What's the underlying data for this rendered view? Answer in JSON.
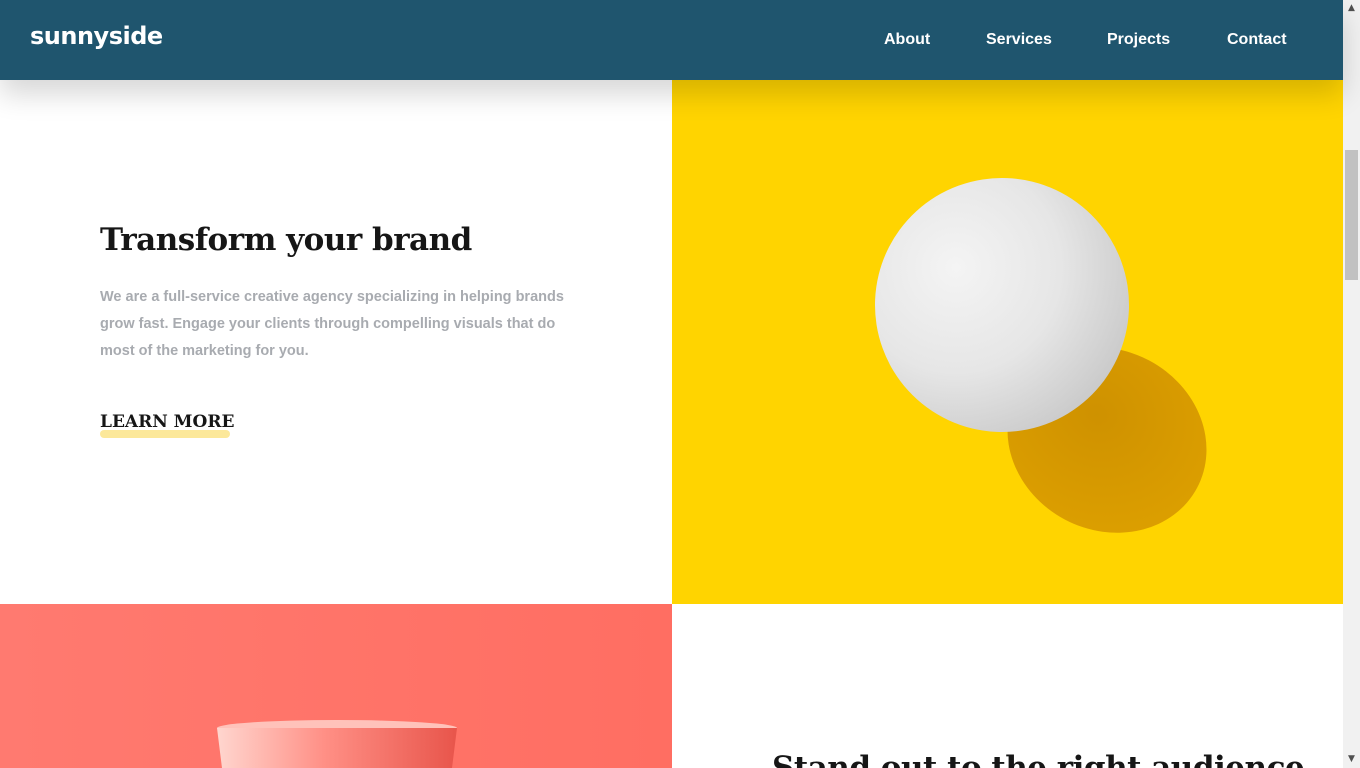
{
  "header": {
    "logo": "sunnyside",
    "nav": [
      {
        "label": "About"
      },
      {
        "label": "Services"
      },
      {
        "label": "Projects"
      },
      {
        "label": "Contact"
      }
    ]
  },
  "hero": {
    "title": "Transform your brand",
    "description": "We are a full-service creative agency specializing in helping brands grow fast. Engage your clients through compelling visuals that do most of the marketing for you.",
    "cta": "LEARN MORE"
  },
  "section2": {
    "title": "Stand out to the right audience"
  },
  "colors": {
    "header_bg": "#1f556e",
    "egg_bg": "#ffd400",
    "glass_bg": "#ff6e62",
    "underline": "#fbe488"
  },
  "icons": {
    "scroll_up": "triangle-up-icon",
    "scroll_down": "triangle-down-icon"
  }
}
